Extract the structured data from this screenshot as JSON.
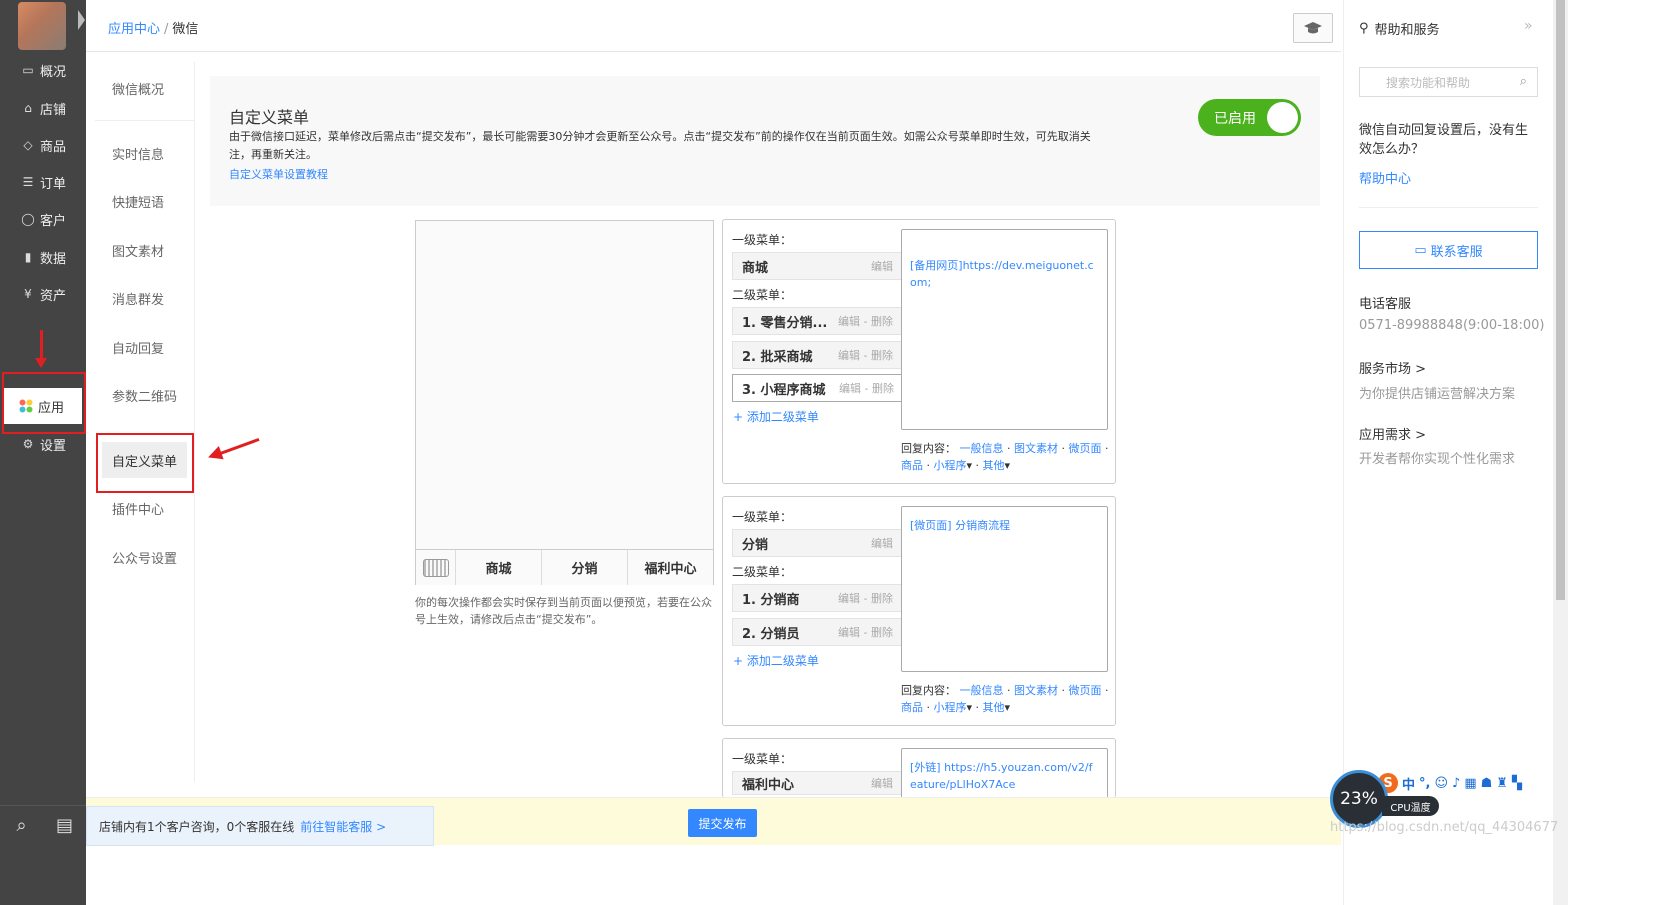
{
  "nav": {
    "items": [
      {
        "label": "概况",
        "icon": "monitor-icon"
      },
      {
        "label": "店铺",
        "icon": "store-icon"
      },
      {
        "label": "商品",
        "icon": "tag-icon"
      },
      {
        "label": "订单",
        "icon": "list-icon"
      },
      {
        "label": "客户",
        "icon": "user-icon"
      },
      {
        "label": "数据",
        "icon": "bar-chart-icon"
      },
      {
        "label": "资产",
        "icon": "yuan-icon"
      },
      {
        "label": "应用",
        "icon": "apps-icon"
      },
      {
        "label": "设置",
        "icon": "gear-icon"
      }
    ]
  },
  "breadcrumb": {
    "root": "应用中心",
    "sep": "/",
    "current": "微信"
  },
  "subnav": {
    "items": [
      "微信概况",
      "实时信息",
      "快捷短语",
      "图文素材",
      "消息群发",
      "自动回复",
      "参数二维码",
      "自定义菜单",
      "插件中心",
      "公众号设置"
    ],
    "active": "自定义菜单"
  },
  "notice": {
    "title": "自定义菜单",
    "desc": "由于微信接口延迟，菜单修改后需点击“提交发布”，最长可能需要30分钟才会更新至公众号。点击“提交发布”前的操作仅在当前页面生效。如需公众号菜单即时生效，可先取消关注，再重新关注。",
    "link": "自定义菜单设置教程",
    "toggle_label": "已启用"
  },
  "phone": {
    "menus": [
      "商城",
      "分销",
      "福利中心"
    ],
    "hint": "你的每次操作都会实时保存到当前页面以便预览，若要在公众号上生效，请修改后点击“提交发布”。"
  },
  "menu_blocks": {
    "level1_label": "一级菜单：",
    "level2_label": "二级菜单：",
    "edit": "编辑",
    "edit_delete": "编辑 - 删除",
    "add_sub": "+ 添加二级菜单",
    "reply_prefix": "回复内容：",
    "reply_opts": [
      "一般信息",
      "图文素材",
      "微页面",
      "商品",
      "小程序",
      "其他"
    ],
    "blocks": [
      {
        "name": "商城",
        "subs": [
          "1. 零售分销...",
          "2. 批采商城",
          "3. 小程序商城"
        ],
        "content": "[备用网页]https://dev.meiguonet.com;"
      },
      {
        "name": "分销",
        "subs": [
          "1. 分销商",
          "2. 分销员"
        ],
        "content": "[微页面] 分销商流程"
      },
      {
        "name": "福利中心",
        "subs": [],
        "content": "[外链] https://h5.youzan.com/v2/feature/pLlHoX7Ace"
      }
    ]
  },
  "help": {
    "title": "帮助和服务",
    "search_placeholder": "搜索功能和帮助",
    "question": "微信自动回复设置后，没有生效怎么办？",
    "help_center": "帮助中心",
    "contact": "联系客服",
    "phone_title": "电话客服",
    "phone": "0571-89988848(9:00-18:00)",
    "market_title": "服务市场 >",
    "market_sub": "为你提供店铺运营解决方案",
    "need_title": "应用需求 >",
    "need_sub": "开发者帮你实现个性化需求"
  },
  "bottom": {
    "notice": "店铺内有1个客户咨询，0个客服在线",
    "notice_link": "前往智能客服 >",
    "submit": "提交发布"
  },
  "tray": {
    "cpu_value": "23%",
    "cpu_label": "CPU温度",
    "ime_char": "中"
  },
  "watermark": "https://blog.csdn.net/qq_44304677"
}
